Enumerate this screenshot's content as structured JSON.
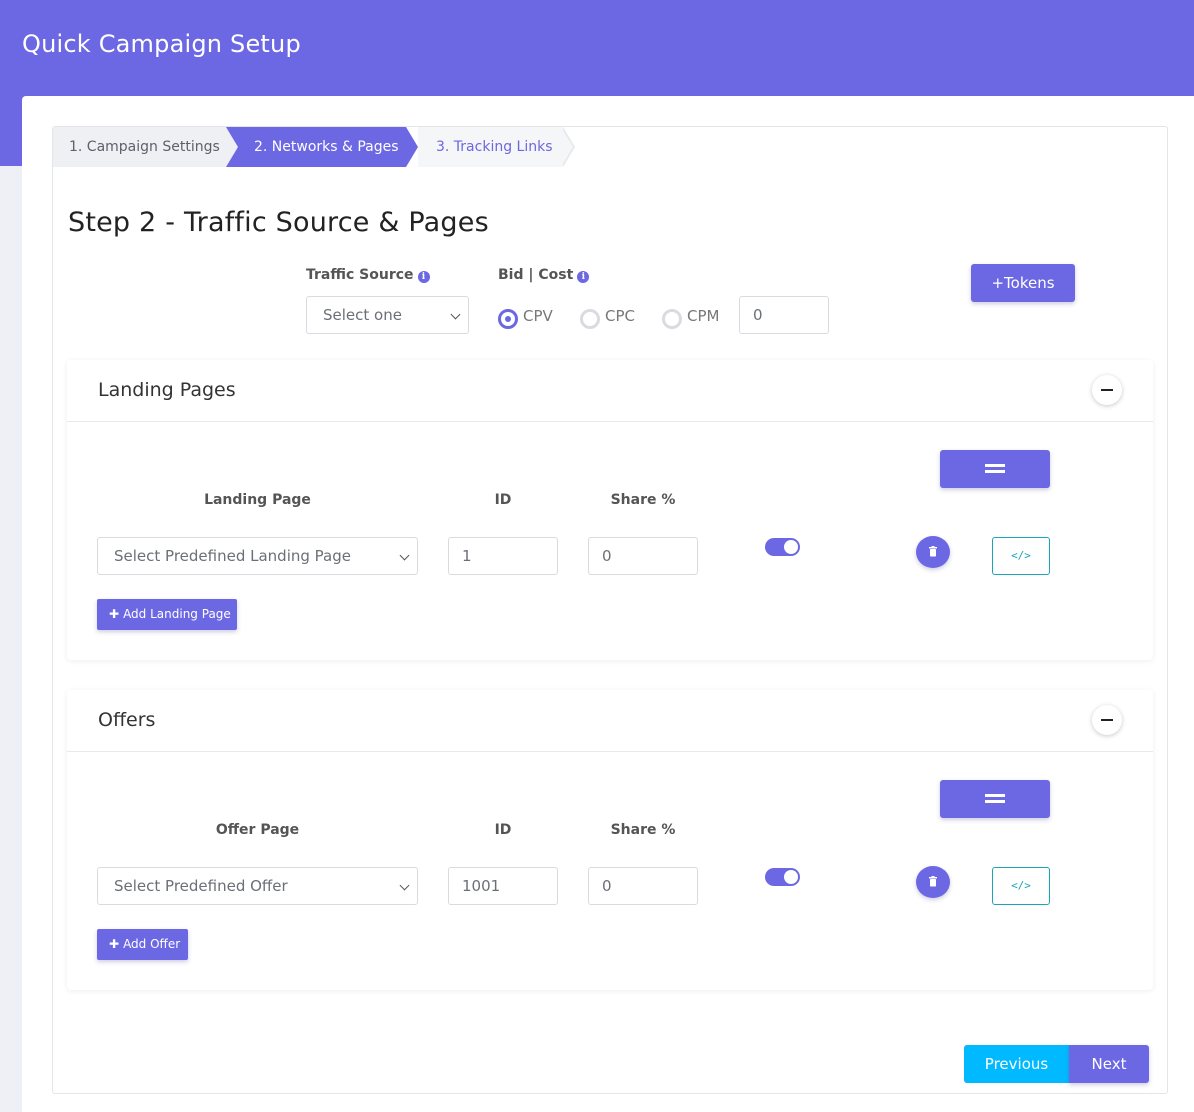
{
  "header": {
    "title": "Quick Campaign Setup"
  },
  "stepper": {
    "steps": [
      {
        "label": "1. Campaign Settings"
      },
      {
        "label": "2. Networks & Pages"
      },
      {
        "label": "3. Tracking Links"
      }
    ],
    "active_index": 1
  },
  "step_heading": "Step 2 - Traffic Source & Pages",
  "traffic_source": {
    "label": "Traffic Source",
    "selected": "Select one"
  },
  "bid_cost": {
    "label": "Bid | Cost",
    "options": [
      "CPV",
      "CPC",
      "CPM"
    ],
    "selected": "CPV",
    "value": "0"
  },
  "tokens_button": "+Tokens",
  "landing_pages": {
    "title": "Landing Pages",
    "columns": {
      "page": "Landing Page",
      "id": "ID",
      "share": "Share %"
    },
    "rows": [
      {
        "selected": "Select Predefined Landing Page",
        "id": "1",
        "share": "0",
        "enabled": true
      }
    ],
    "add_label": "Add Landing Page",
    "code_label": "</>"
  },
  "offers": {
    "title": "Offers",
    "columns": {
      "page": "Offer Page",
      "id": "ID",
      "share": "Share %"
    },
    "rows": [
      {
        "selected": "Select Predefined Offer",
        "id": "1001",
        "share": "0",
        "enabled": true
      }
    ],
    "add_label": "Add Offer",
    "code_label": "</>"
  },
  "nav": {
    "previous": "Previous",
    "next": "Next"
  },
  "colors": {
    "primary": "#6c67e3",
    "previous": "#00b9ff",
    "code_outline": "#1aa6b7"
  }
}
